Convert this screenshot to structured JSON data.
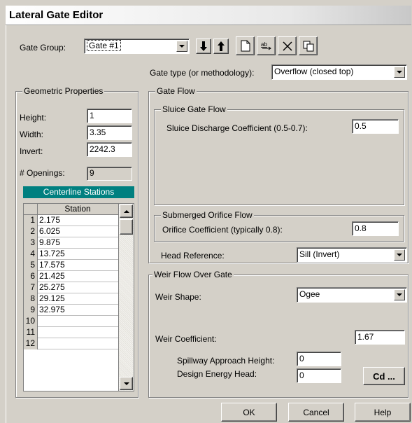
{
  "window": {
    "title": "Lateral Gate Editor"
  },
  "gate_group": {
    "label": "Gate Group:",
    "value": "Gate #1"
  },
  "toolbar": {
    "icons": [
      "arrow-down-icon",
      "arrow-up-icon",
      "new-page-icon",
      "rename-icon",
      "delete-icon",
      "copy-icon"
    ]
  },
  "gate_type": {
    "label": "Gate type (or methodology):",
    "value": "Overflow (closed top)"
  },
  "geometric": {
    "title": "Geometric Properties",
    "height_label": "Height:",
    "height_value": "1",
    "width_label": "Width:",
    "width_value": "3.35",
    "invert_label": "Invert:",
    "invert_value": "2242.3",
    "openings_label": "# Openings:",
    "openings_value": "9"
  },
  "stations": {
    "title": "Centerline Stations",
    "column_header": "Station",
    "rows": [
      {
        "num": "1",
        "value": "2.175"
      },
      {
        "num": "2",
        "value": "6.025"
      },
      {
        "num": "3",
        "value": "9.875"
      },
      {
        "num": "4",
        "value": "13.725"
      },
      {
        "num": "5",
        "value": "17.575"
      },
      {
        "num": "6",
        "value": "21.425"
      },
      {
        "num": "7",
        "value": "25.275"
      },
      {
        "num": "8",
        "value": "29.125"
      },
      {
        "num": "9",
        "value": "32.975"
      },
      {
        "num": "10",
        "value": ""
      },
      {
        "num": "11",
        "value": ""
      },
      {
        "num": "12",
        "value": ""
      }
    ]
  },
  "gate_flow": {
    "title": "Gate Flow",
    "sluice": {
      "title": "Sluice Gate Flow",
      "coef_label": "Sluice Discharge Coefficient (0.5-0.7):",
      "coef_value": "0.5"
    },
    "orifice": {
      "title": "Submerged Orifice Flow",
      "coef_label": "Orifice Coefficient (typically 0.8):",
      "coef_value": "0.8"
    },
    "head_reference": {
      "label": "Head Reference:",
      "value": "Sill (Invert)"
    }
  },
  "weir": {
    "title": "Weir Flow Over Gate",
    "shape_label": "Weir Shape:",
    "shape_value": "Ogee",
    "coef_label": "Weir Coefficient:",
    "coef_value": "1.67",
    "spillway_label": "Spillway Approach Height:",
    "spillway_value": "0",
    "design_label": "Design Energy Head:",
    "design_value": "0",
    "cd_button": "Cd ..."
  },
  "buttons": {
    "ok": "OK",
    "cancel": "Cancel",
    "help": "Help"
  }
}
